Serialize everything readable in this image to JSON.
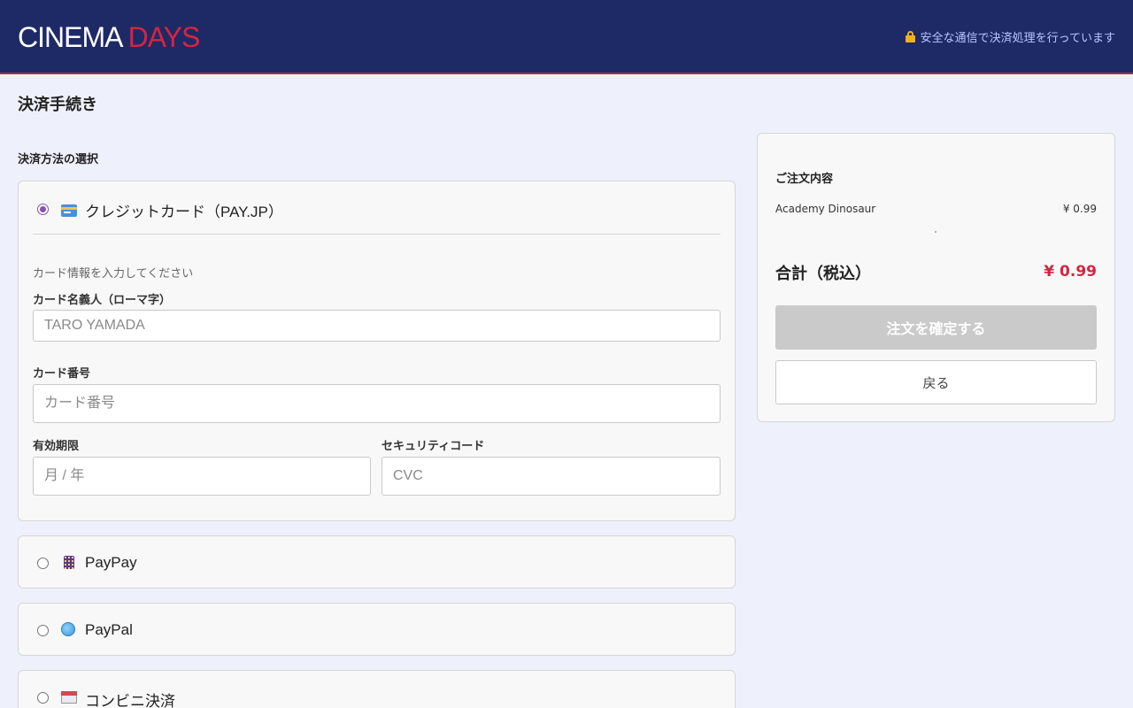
{
  "header": {
    "logo_main": "CINEMA ",
    "logo_accent": "DAYS",
    "secure_text": "安全な通信で決済処理を行っています"
  },
  "page": {
    "title": "決済手続き",
    "section_label": "決済方法の選択"
  },
  "payment_methods": [
    {
      "label": "クレジットカード（PAY.JP）",
      "icon": "credit-card-icon",
      "selected": true
    },
    {
      "label": "PayPay",
      "icon": "mobile-phone-icon",
      "selected": false
    },
    {
      "label": "PayPal",
      "icon": "globe-icon",
      "selected": false
    },
    {
      "label": "コンビニ決済",
      "icon": "convenience-store-icon",
      "selected": false
    }
  ],
  "card_form": {
    "hint": "カード情報を入力してください",
    "holder_label": "カード名義人（ローマ字）",
    "holder_placeholder": "TARO YAMADA",
    "number_label": "カード番号",
    "number_placeholder": "カード番号",
    "expiry_label": "有効期限",
    "expiry_placeholder": "月 / 年",
    "cvc_label": "セキュリティコード",
    "cvc_placeholder": "CVC"
  },
  "summary": {
    "title": "ご注文内容",
    "items": [
      {
        "name": "Academy Dinosaur",
        "price": "¥ 0.99"
      }
    ],
    "total_label": "合計（税込）",
    "total_value": "¥ 0.99",
    "confirm_label": "注文を確定する",
    "back_label": "戻る"
  },
  "colors": {
    "header_bg": "#1e2a66",
    "accent": "#d62440",
    "radio_selected": "#8a4fb5"
  }
}
